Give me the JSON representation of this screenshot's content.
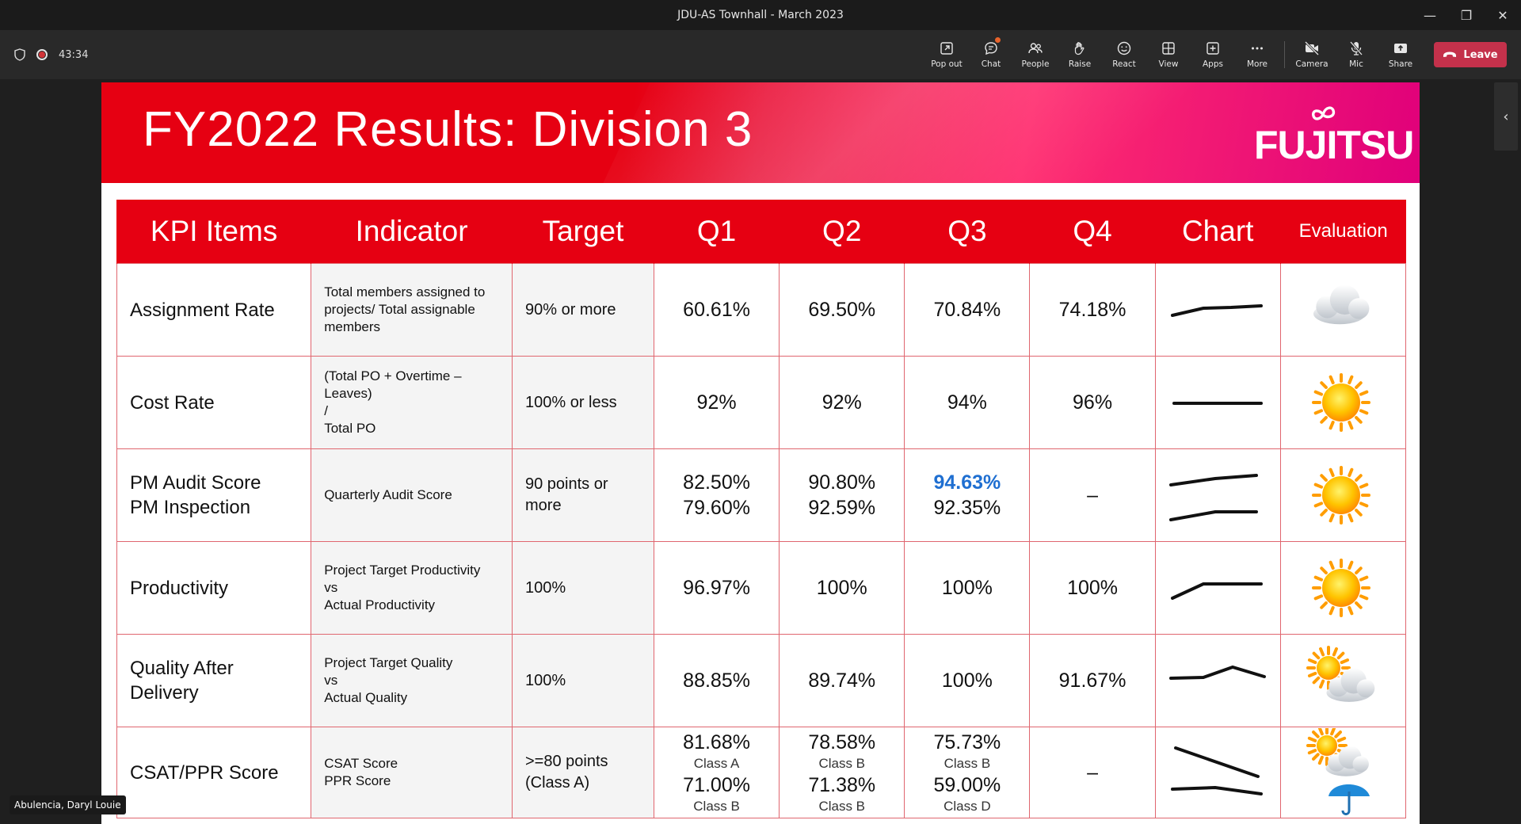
{
  "window": {
    "title": "JDU-AS Townhall - March 2023"
  },
  "meeting": {
    "timer": "43:34",
    "toolbar": [
      {
        "label": "Pop out",
        "icon": "pop-out-icon"
      },
      {
        "label": "Chat",
        "icon": "chat-icon"
      },
      {
        "label": "People",
        "icon": "people-icon"
      },
      {
        "label": "Raise",
        "icon": "raise-hand-icon"
      },
      {
        "label": "React",
        "icon": "react-icon"
      },
      {
        "label": "View",
        "icon": "view-icon"
      },
      {
        "label": "Apps",
        "icon": "apps-icon"
      },
      {
        "label": "More",
        "icon": "more-icon"
      },
      {
        "label": "Camera",
        "icon": "camera-off-icon"
      },
      {
        "label": "Mic",
        "icon": "mic-off-icon"
      },
      {
        "label": "Share",
        "icon": "share-icon"
      }
    ],
    "leave_label": "Leave",
    "participant_name": "Abulencia, Daryl Louie"
  },
  "slide": {
    "title": "FY2022 Results: Division 3",
    "logo_text": "FUJITSU",
    "headers": [
      "KPI Items",
      "Indicator",
      "Target",
      "Q1",
      "Q2",
      "Q3",
      "Q4",
      "Chart",
      "Evaluation"
    ],
    "rows": [
      {
        "kpi": [
          "Assignment Rate"
        ],
        "indicator": [
          "Total members assigned to",
          "projects/ Total assignable",
          "members"
        ],
        "target": [
          "90% or more"
        ],
        "q1": [
          {
            "v": "60.61%"
          }
        ],
        "q2": [
          {
            "v": "69.50%"
          }
        ],
        "q3": [
          {
            "v": "70.84%"
          }
        ],
        "q4": [
          {
            "v": "74.18%"
          }
        ],
        "evaluation": "cloudy"
      },
      {
        "kpi": [
          "Cost Rate"
        ],
        "indicator": [
          "(Total PO + Overtime –",
          "Leaves)",
          "/",
          "Total PO"
        ],
        "target": [
          "100% or less"
        ],
        "q1": [
          {
            "v": "92%"
          }
        ],
        "q2": [
          {
            "v": "92%"
          }
        ],
        "q3": [
          {
            "v": "94%"
          }
        ],
        "q4": [
          {
            "v": "96%"
          }
        ],
        "evaluation": "sunny"
      },
      {
        "kpi": [
          "PM Audit Score",
          "PM Inspection"
        ],
        "indicator": [
          "Quarterly Audit Score"
        ],
        "target": [
          "90 points or",
          "more"
        ],
        "q1": [
          {
            "v": "82.50%"
          },
          {
            "v": "79.60%"
          }
        ],
        "q2": [
          {
            "v": "90.80%"
          },
          {
            "v": "92.59%"
          }
        ],
        "q3": [
          {
            "v": "94.63%",
            "hl": true
          },
          {
            "v": "92.35%"
          }
        ],
        "q4": [
          {
            "v": "–"
          }
        ],
        "evaluation": "sunny"
      },
      {
        "kpi": [
          "Productivity"
        ],
        "indicator": [
          "Project Target Productivity",
          "vs",
          "Actual Productivity"
        ],
        "target": [
          "100%"
        ],
        "q1": [
          {
            "v": "96.97%"
          }
        ],
        "q2": [
          {
            "v": "100%"
          }
        ],
        "q3": [
          {
            "v": "100%"
          }
        ],
        "q4": [
          {
            "v": "100%"
          }
        ],
        "evaluation": "sunny"
      },
      {
        "kpi": [
          "Quality After",
          "Delivery"
        ],
        "indicator": [
          "Project Target Quality",
          "vs",
          "Actual Quality"
        ],
        "target": [
          "100%"
        ],
        "q1": [
          {
            "v": "88.85%"
          }
        ],
        "q2": [
          {
            "v": "89.74%"
          }
        ],
        "q3": [
          {
            "v": "100%"
          }
        ],
        "q4": [
          {
            "v": "91.67%"
          }
        ],
        "evaluation": "partly-cloudy"
      },
      {
        "kpi": [
          "CSAT/PPR Score"
        ],
        "indicator": [
          "CSAT Score",
          "PPR Score"
        ],
        "target": [
          ">=80 points",
          "(Class A)"
        ],
        "q1": [
          {
            "v": "81.68%",
            "cls": "Class A"
          },
          {
            "v": "71.00%",
            "cls": "Class B"
          }
        ],
        "q2": [
          {
            "v": "78.58%",
            "cls": "Class B"
          },
          {
            "v": "71.38%",
            "cls": "Class B"
          }
        ],
        "q3": [
          {
            "v": "75.73%",
            "cls": "Class B"
          },
          {
            "v": "59.00%",
            "cls": "Class D"
          }
        ],
        "q4": [
          {
            "v": "–"
          }
        ],
        "evaluation": "partly-cloudy-rain"
      }
    ]
  }
}
